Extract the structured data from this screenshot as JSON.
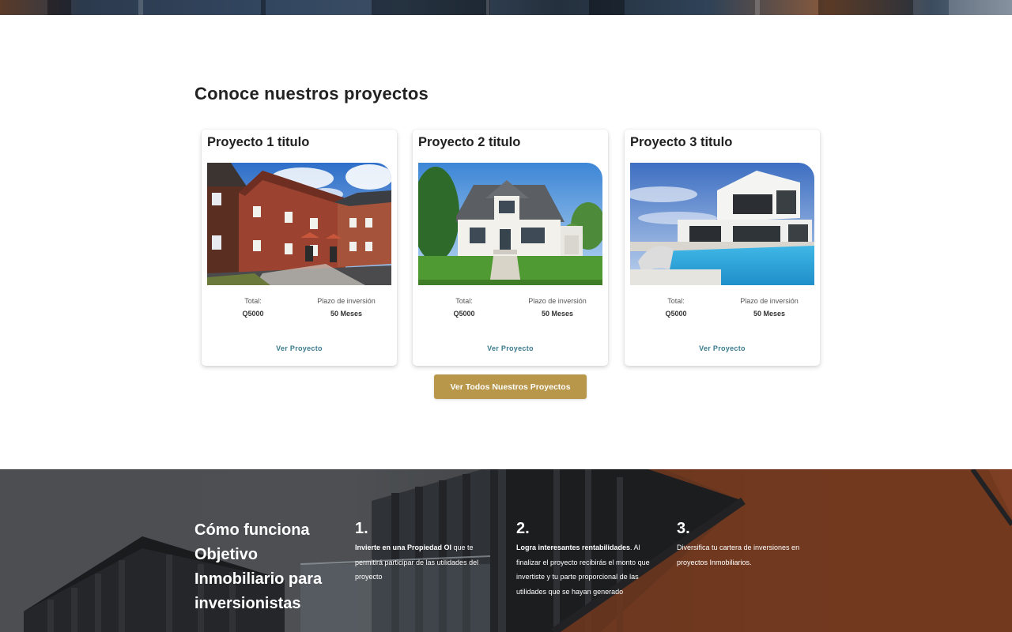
{
  "projects_section": {
    "title": "Conoce nuestros proyectos",
    "cards": [
      {
        "title": "Proyecto 1 titulo",
        "total_label": "Total:",
        "total_value": "Q5000",
        "term_label": "Plazo de inversión",
        "term_value": "50 Meses",
        "link_label": "Ver Proyecto",
        "image": "brick-townhouses-photo"
      },
      {
        "title": "Proyecto 2 titulo",
        "total_label": "Total:",
        "total_value": "Q5000",
        "term_label": "Plazo de inversión",
        "term_value": "50 Meses",
        "link_label": "Ver Proyecto",
        "image": "white-suburban-house-photo"
      },
      {
        "title": "Proyecto 3 titulo",
        "total_label": "Total:",
        "total_value": "Q5000",
        "term_label": "Plazo de inversión",
        "term_value": "50 Meses",
        "link_label": "Ver Proyecto",
        "image": "modern-house-pool-photo"
      }
    ],
    "all_projects_button": "Ver Todos Nuestros Proyectos"
  },
  "how_it_works": {
    "title": "Cómo funciona Objetivo Inmobiliario para inversionistas",
    "steps": [
      {
        "number": "1.",
        "bold": "Invierte en una Propiedad OI",
        "text": " que te permitirá participar de las utilidades del proyecto"
      },
      {
        "number": "2.",
        "bold": "Logra interesantes rentabilidades",
        "text": ". Al finalizar el proyecto recibirás el monto que invertiste y tu parte proporcional de las utilidades que se hayan generado"
      },
      {
        "number": "3.",
        "bold": "",
        "text": "Diversifica tu cartera de inversiones en proyectos Inmobiliarios."
      }
    ]
  },
  "colors": {
    "accent_button": "#b8964a",
    "link": "#3a7a8c"
  }
}
